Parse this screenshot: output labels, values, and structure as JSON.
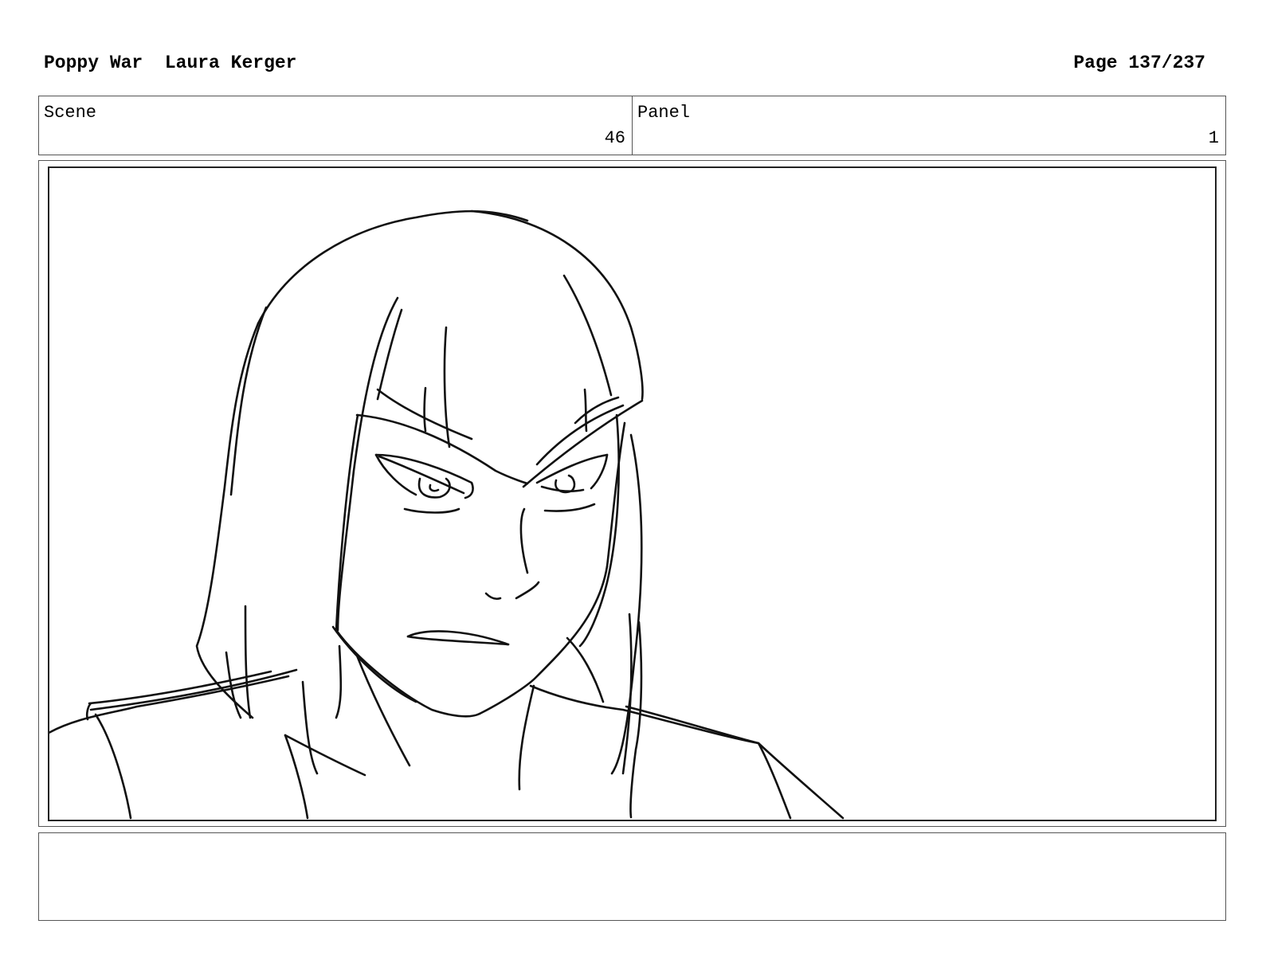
{
  "header": {
    "title": "Poppy War",
    "author": "Laura Kerger",
    "page_label": "Page 137/237"
  },
  "info": {
    "scene_label": "Scene",
    "scene_number": "46",
    "panel_label": "Panel",
    "panel_number": "1"
  },
  "notes": {
    "text": ""
  }
}
